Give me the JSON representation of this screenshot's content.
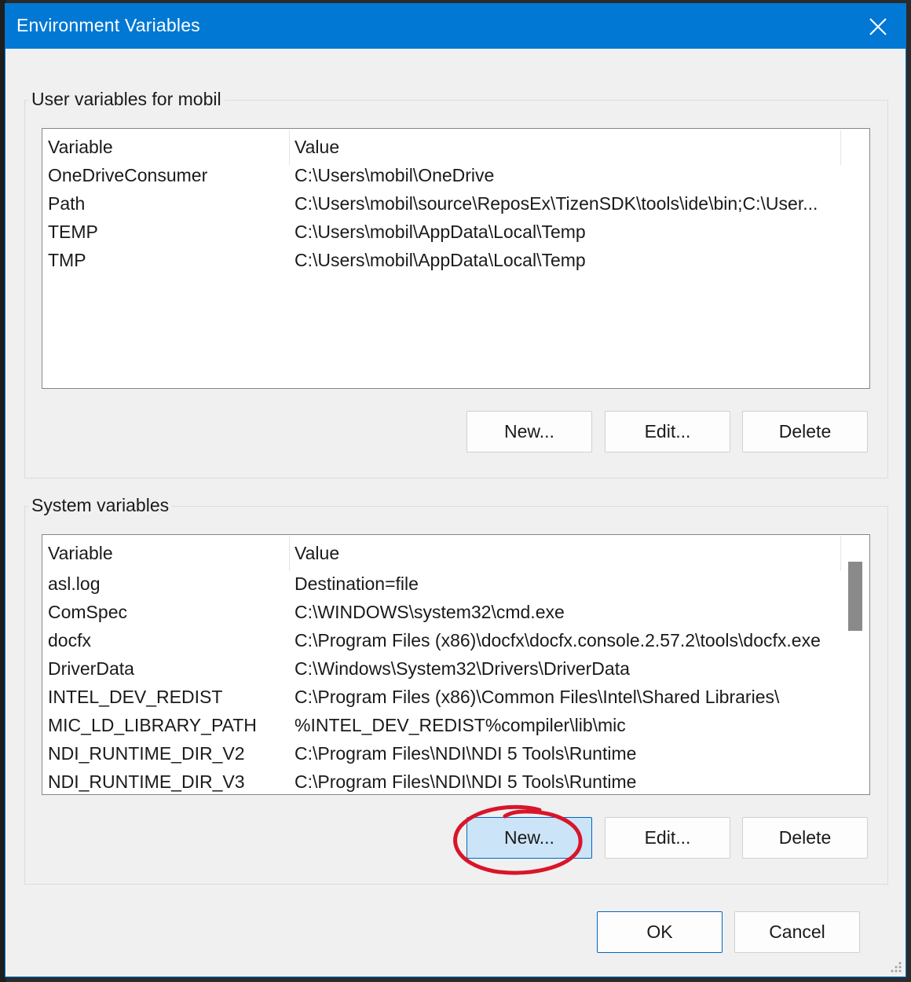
{
  "window": {
    "title": "Environment Variables",
    "accent_color": "#0078d4",
    "close_icon": "close-icon"
  },
  "user_vars": {
    "group_label": "User variables for mobil",
    "columns": {
      "variable": "Variable",
      "value": "Value"
    },
    "rows": [
      {
        "variable": "OneDriveConsumer",
        "value": "C:\\Users\\mobil\\OneDrive"
      },
      {
        "variable": "Path",
        "value": "C:\\Users\\mobil\\source\\ReposEx\\TizenSDK\\tools\\ide\\bin;C:\\User..."
      },
      {
        "variable": "TEMP",
        "value": "C:\\Users\\mobil\\AppData\\Local\\Temp"
      },
      {
        "variable": "TMP",
        "value": "C:\\Users\\mobil\\AppData\\Local\\Temp"
      }
    ],
    "buttons": {
      "new": "New...",
      "edit": "Edit...",
      "delete": "Delete"
    }
  },
  "system_vars": {
    "group_label": "System variables",
    "columns": {
      "variable": "Variable",
      "value": "Value"
    },
    "rows": [
      {
        "variable": "asl.log",
        "value": "Destination=file"
      },
      {
        "variable": "ComSpec",
        "value": "C:\\WINDOWS\\system32\\cmd.exe"
      },
      {
        "variable": "docfx",
        "value": "C:\\Program Files (x86)\\docfx\\docfx.console.2.57.2\\tools\\docfx.exe"
      },
      {
        "variable": "DriverData",
        "value": "C:\\Windows\\System32\\Drivers\\DriverData"
      },
      {
        "variable": "INTEL_DEV_REDIST",
        "value": "C:\\Program Files (x86)\\Common Files\\Intel\\Shared Libraries\\"
      },
      {
        "variable": "MIC_LD_LIBRARY_PATH",
        "value": "%INTEL_DEV_REDIST%compiler\\lib\\mic"
      },
      {
        "variable": "NDI_RUNTIME_DIR_V2",
        "value": "C:\\Program Files\\NDI\\NDI 5 Tools\\Runtime"
      },
      {
        "variable": "NDI_RUNTIME_DIR_V3",
        "value": "C:\\Program Files\\NDI\\NDI 5 Tools\\Runtime"
      }
    ],
    "buttons": {
      "new": "New...",
      "edit": "Edit...",
      "delete": "Delete"
    },
    "scroll_position": 0.0
  },
  "footer": {
    "ok": "OK",
    "cancel": "Cancel"
  },
  "annotation": {
    "color": "#d9152a",
    "target": "system-new-button"
  }
}
